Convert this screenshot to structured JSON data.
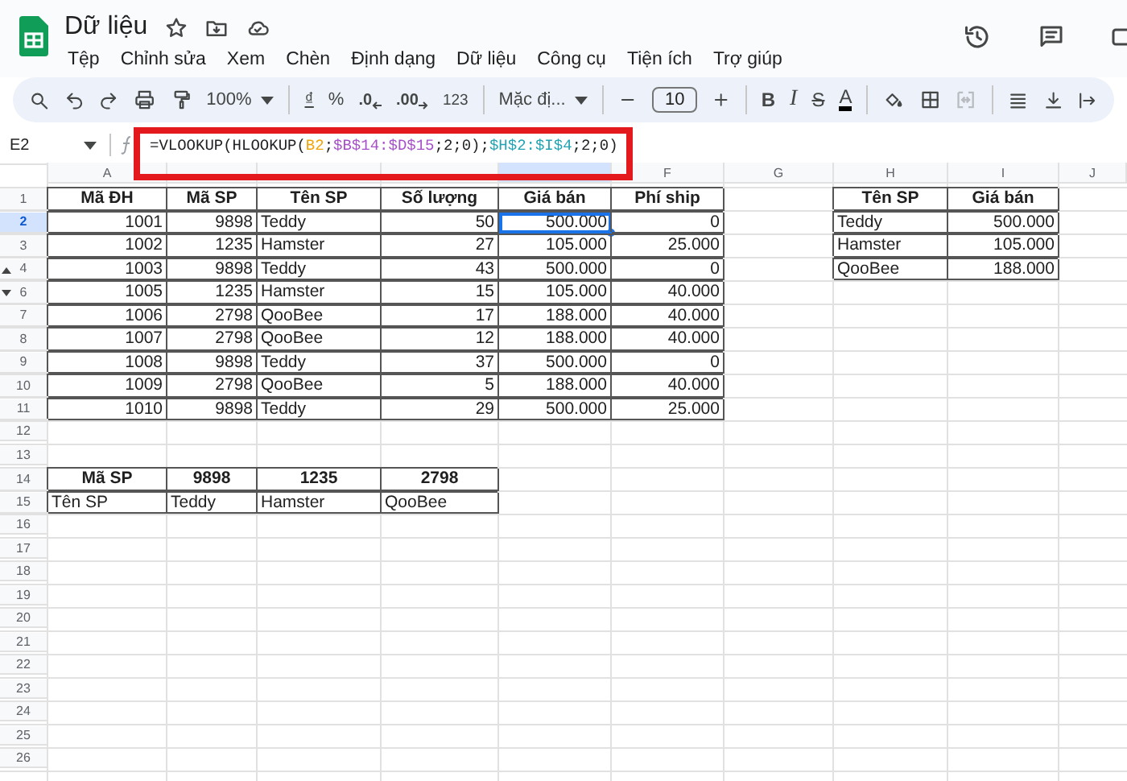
{
  "app": {
    "title": "Dữ liệu",
    "menu": [
      "Tệp",
      "Chỉnh sửa",
      "Xem",
      "Chèn",
      "Định dạng",
      "Dữ liệu",
      "Công cụ",
      "Tiện ích",
      "Trợ giúp"
    ]
  },
  "toolbar": {
    "zoom": "100%",
    "currency": "₫",
    "percent": "%",
    "decrease_decimals": ".0",
    "increase_decimals": ".00",
    "number_format": "123",
    "font": "Mặc đị...",
    "font_size": "10",
    "bold": "B",
    "italic": "I",
    "strikethrough": "S",
    "text_color": "A",
    "merge_disabled": true
  },
  "formula_bar": {
    "cell": "E2",
    "formula": [
      {
        "text": "=VLOOKUP(HLOOKUP(",
        "color": "#202124"
      },
      {
        "text": "B2",
        "color": "#f0a30a"
      },
      {
        "text": ";",
        "color": "#202124"
      },
      {
        "text": "$B$14:$D$15",
        "color": "#a650c8"
      },
      {
        "text": ";2;0);",
        "color": "#202124"
      },
      {
        "text": "$H$2:$I$4",
        "color": "#21a3b3"
      },
      {
        "text": ";2;0)",
        "color": "#202124"
      }
    ]
  },
  "columns": [
    {
      "label": "A",
      "selected": false
    },
    {
      "selected": false
    },
    {
      "selected": false
    },
    {
      "selected": false
    },
    {
      "selected": true
    },
    {
      "label": "F",
      "selected": false
    },
    {
      "label": "G",
      "selected": false
    },
    {
      "label": "H",
      "selected": false
    },
    {
      "label": "I",
      "selected": false
    },
    {
      "label": "J",
      "selected": false
    }
  ],
  "rows": [
    {
      "number": "1",
      "selected": false,
      "cells": [
        {
          "text": "Mã ĐH",
          "kind": "header",
          "bordered": true
        },
        {
          "text": "Mã SP",
          "kind": "header",
          "bordered": true
        },
        {
          "text": "Tên SP",
          "kind": "header",
          "bordered": true
        },
        {
          "text": "Số lượng",
          "kind": "header",
          "bordered": true
        },
        {
          "text": "Giá bán",
          "kind": "header",
          "bordered": true
        },
        {
          "text": "Phí ship",
          "kind": "header",
          "bordered": true
        },
        null,
        {
          "text": "Tên SP",
          "kind": "header",
          "bordered": true
        },
        {
          "text": "Giá bán",
          "kind": "header",
          "bordered": true
        }
      ]
    },
    {
      "number": "2",
      "selected": true,
      "cells": [
        {
          "text": "1001",
          "kind": "number",
          "bordered": true
        },
        {
          "text": "9898",
          "kind": "number",
          "bordered": true
        },
        {
          "text": "Teddy",
          "kind": "text",
          "bordered": true
        },
        {
          "text": "50",
          "kind": "number",
          "bordered": true
        },
        {
          "text": "500.000",
          "kind": "number",
          "bordered": true
        },
        {
          "text": "0",
          "kind": "number",
          "bordered": true
        },
        null,
        {
          "text": "Teddy",
          "kind": "text",
          "bordered": true
        },
        {
          "text": "500.000",
          "kind": "number",
          "bordered": true
        }
      ]
    },
    {
      "number": "3",
      "selected": false,
      "cells": [
        {
          "text": "1002",
          "kind": "number",
          "bordered": true
        },
        {
          "text": "1235",
          "kind": "number",
          "bordered": true
        },
        {
          "text": "Hamster",
          "kind": "text",
          "bordered": true
        },
        {
          "text": "27",
          "kind": "number",
          "bordered": true
        },
        {
          "text": "105.000",
          "kind": "number",
          "bordered": true
        },
        {
          "text": "25.000",
          "kind": "number",
          "bordered": true
        },
        null,
        {
          "text": "Hamster",
          "kind": "text",
          "bordered": true
        },
        {
          "text": "105.000",
          "kind": "number",
          "bordered": true
        }
      ]
    },
    {
      "number": "4",
      "selected": false,
      "hidden_rows_below": true,
      "cells": [
        {
          "text": "1003",
          "kind": "number",
          "bordered": true
        },
        {
          "text": "9898",
          "kind": "number",
          "bordered": true
        },
        {
          "text": "Teddy",
          "kind": "text",
          "bordered": true
        },
        {
          "text": "43",
          "kind": "number",
          "bordered": true
        },
        {
          "text": "500.000",
          "kind": "number",
          "bordered": true
        },
        {
          "text": "0",
          "kind": "number",
          "bordered": true
        },
        null,
        {
          "text": "QooBee",
          "kind": "text",
          "bordered": true
        },
        {
          "text": "188.000",
          "kind": "number",
          "bordered": true
        }
      ]
    },
    {
      "number": "6",
      "selected": false,
      "hidden_rows_above": true,
      "cells": [
        {
          "text": "1005",
          "kind": "number",
          "bordered": true
        },
        {
          "text": "1235",
          "kind": "number",
          "bordered": true
        },
        {
          "text": "Hamster",
          "kind": "text",
          "bordered": true
        },
        {
          "text": "15",
          "kind": "number",
          "bordered": true
        },
        {
          "text": "105.000",
          "kind": "number",
          "bordered": true
        },
        {
          "text": "40.000",
          "kind": "number",
          "bordered": true
        }
      ]
    },
    {
      "number": "7",
      "selected": false,
      "cells": [
        {
          "text": "1006",
          "kind": "number",
          "bordered": true
        },
        {
          "text": "2798",
          "kind": "number",
          "bordered": true
        },
        {
          "text": "QooBee",
          "kind": "text",
          "bordered": true
        },
        {
          "text": "17",
          "kind": "number",
          "bordered": true
        },
        {
          "text": "188.000",
          "kind": "number",
          "bordered": true
        },
        {
          "text": "40.000",
          "kind": "number",
          "bordered": true
        }
      ]
    },
    {
      "number": "8",
      "selected": false,
      "cells": [
        {
          "text": "1007",
          "kind": "number",
          "bordered": true
        },
        {
          "text": "2798",
          "kind": "number",
          "bordered": true
        },
        {
          "text": "QooBee",
          "kind": "text",
          "bordered": true
        },
        {
          "text": "12",
          "kind": "number",
          "bordered": true
        },
        {
          "text": "188.000",
          "kind": "number",
          "bordered": true
        },
        {
          "text": "40.000",
          "kind": "number",
          "bordered": true
        }
      ]
    },
    {
      "number": "9",
      "selected": false,
      "cells": [
        {
          "text": "1008",
          "kind": "number",
          "bordered": true
        },
        {
          "text": "9898",
          "kind": "number",
          "bordered": true
        },
        {
          "text": "Teddy",
          "kind": "text",
          "bordered": true
        },
        {
          "text": "37",
          "kind": "number",
          "bordered": true
        },
        {
          "text": "500.000",
          "kind": "number",
          "bordered": true
        },
        {
          "text": "0",
          "kind": "number",
          "bordered": true
        }
      ]
    },
    {
      "number": "10",
      "selected": false,
      "cells": [
        {
          "text": "1009",
          "kind": "number",
          "bordered": true
        },
        {
          "text": "2798",
          "kind": "number",
          "bordered": true
        },
        {
          "text": "QooBee",
          "kind": "text",
          "bordered": true
        },
        {
          "text": "5",
          "kind": "number",
          "bordered": true
        },
        {
          "text": "188.000",
          "kind": "number",
          "bordered": true
        },
        {
          "text": "40.000",
          "kind": "number",
          "bordered": true
        }
      ]
    },
    {
      "number": "11",
      "selected": false,
      "cells": [
        {
          "text": "1010",
          "kind": "number",
          "bordered": true
        },
        {
          "text": "9898",
          "kind": "number",
          "bordered": true
        },
        {
          "text": "Teddy",
          "kind": "text",
          "bordered": true
        },
        {
          "text": "29",
          "kind": "number",
          "bordered": true
        },
        {
          "text": "500.000",
          "kind": "number",
          "bordered": true
        },
        {
          "text": "25.000",
          "kind": "number",
          "bordered": true
        }
      ]
    },
    {
      "number": "12",
      "selected": false
    },
    {
      "number": "13",
      "selected": false
    },
    {
      "number": "14",
      "selected": false,
      "cells": [
        {
          "text": "Mã SP",
          "kind": "header",
          "bordered": true
        },
        {
          "text": "9898",
          "kind": "header",
          "bordered": true
        },
        {
          "text": "1235",
          "kind": "header",
          "bordered": true
        },
        {
          "text": "2798",
          "kind": "header",
          "bordered": true
        }
      ]
    },
    {
      "number": "15",
      "selected": false,
      "cells": [
        {
          "text": "Tên SP",
          "kind": "text",
          "bordered": true
        },
        {
          "text": "Teddy",
          "kind": "text",
          "bordered": true
        },
        {
          "text": "Hamster",
          "kind": "text",
          "bordered": true
        },
        {
          "text": "QooBee",
          "kind": "text",
          "bordered": true
        }
      ]
    },
    {
      "number": "16",
      "selected": false
    },
    {
      "number": "17",
      "selected": false
    },
    {
      "number": "18",
      "selected": false
    },
    {
      "number": "19",
      "selected": false
    },
    {
      "number": "20",
      "selected": false
    },
    {
      "number": "21",
      "selected": false
    },
    {
      "number": "22",
      "selected": false
    },
    {
      "number": "23",
      "selected": false
    },
    {
      "number": "24",
      "selected": false
    },
    {
      "number": "25",
      "selected": false
    },
    {
      "number": "26",
      "selected": false
    }
  ]
}
